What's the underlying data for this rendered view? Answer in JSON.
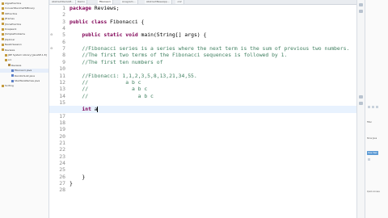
{
  "project_explorer": {
    "items": [
      {
        "label": "AlgosPractice",
        "icon": "folder"
      },
      {
        "label": "ConvertDecimalToBinary",
        "icon": "folder"
      },
      {
        "label": "IOPractice",
        "icon": "folder"
      },
      {
        "label": "JFrames",
        "icon": "folder"
      },
      {
        "label": "JhonsPractice",
        "icon": "folder"
      },
      {
        "label": "Knapsack",
        "icon": "folder"
      },
      {
        "label": "JSimpleProblems",
        "icon": "folder"
      },
      {
        "label": "JSpinner",
        "icon": "folder"
      },
      {
        "label": "NewInSession",
        "icon": "folder"
      },
      {
        "label": "Reviews",
        "icon": "folder"
      },
      {
        "label": "JRE System Library [JavaSE-1.8]",
        "icon": "folder"
      },
      {
        "label": "src",
        "icon": "folder"
      },
      {
        "label": "Reviews",
        "icon": "pkg"
      },
      {
        "label": "Fibonacci.java",
        "icon": "java",
        "selected": true
      },
      {
        "label": "RandomList.java",
        "icon": "java"
      },
      {
        "label": "StarWarsNames.java",
        "icon": "java"
      },
      {
        "label": "Sorting",
        "icon": "folder"
      }
    ]
  },
  "tabs": [
    {
      "label": "AbstractDemoM...",
      "active": false
    },
    {
      "label": "Demo",
      "active": false
    },
    {
      "label": "Fibonacci",
      "active": true
    },
    {
      "label": "Anagram...",
      "active": false
    },
    {
      "label": "AbstractBaseApp...",
      "active": false
    },
    {
      "label": "»12",
      "active": false
    }
  ],
  "code": {
    "line_numbers": [
      "1",
      "2",
      "3",
      "4",
      "5",
      "6",
      "7",
      "8",
      "9",
      "10",
      "11",
      "12",
      "13",
      "14",
      "15",
      "16",
      "17",
      "18",
      "19",
      "20",
      "21",
      "22",
      "23",
      "24",
      "25",
      "26",
      "27",
      "28"
    ],
    "lines": [
      {
        "n": "1",
        "parts": [
          {
            "t": "package Reviews;",
            "c": "plain"
          }
        ]
      },
      {
        "n": "2",
        "parts": []
      },
      {
        "n": "3",
        "parts": [
          {
            "t": "public class Fibonacci {",
            "c": "plain"
          }
        ]
      },
      {
        "n": "4",
        "parts": []
      },
      {
        "n": "5",
        "parts": [
          {
            "t": "    public static void main(String[] args) {",
            "c": "plain"
          }
        ]
      },
      {
        "n": "6",
        "parts": []
      },
      {
        "n": "7",
        "parts": [
          {
            "t": "    //Fibonacci series is a series where the next term is the sum of previous two numbers.",
            "c": "cm"
          }
        ]
      },
      {
        "n": "8",
        "parts": [
          {
            "t": "    //The first two terms of the Fibonacci sequences is followed by 1.",
            "c": "cm"
          }
        ]
      },
      {
        "n": "9",
        "parts": [
          {
            "t": "    //The first ten numbers of",
            "c": "cm"
          }
        ]
      },
      {
        "n": "10",
        "parts": []
      },
      {
        "n": "11",
        "parts": [
          {
            "t": "    //Fibonacci: 1,1,2,3,5,8,13,21,34,55.",
            "c": "cm"
          }
        ]
      },
      {
        "n": "12",
        "parts": [
          {
            "t": "    //            a b c",
            "c": "cm"
          }
        ]
      },
      {
        "n": "13",
        "parts": [
          {
            "t": "    //              a b c",
            "c": "cm"
          }
        ]
      },
      {
        "n": "14",
        "parts": [
          {
            "t": "    //                a b c",
            "c": "cm"
          }
        ]
      },
      {
        "n": "15",
        "parts": []
      },
      {
        "n": "16",
        "parts": [
          {
            "t": "    int a",
            "c": "plain"
          }
        ],
        "current": true
      },
      {
        "n": "17",
        "parts": []
      },
      {
        "n": "18",
        "parts": []
      },
      {
        "n": "19",
        "parts": []
      },
      {
        "n": "20",
        "parts": []
      },
      {
        "n": "21",
        "parts": []
      },
      {
        "n": "22",
        "parts": []
      },
      {
        "n": "23",
        "parts": []
      },
      {
        "n": "24",
        "parts": []
      },
      {
        "n": "25",
        "parts": []
      },
      {
        "n": "26",
        "parts": [
          {
            "t": "    }",
            "c": "plain"
          }
        ]
      },
      {
        "n": "27",
        "parts": [
          {
            "t": "}",
            "c": "plain"
          }
        ]
      },
      {
        "n": "28",
        "parts": []
      }
    ]
  },
  "right_panel": {
    "labels": [
      "Filter",
      "Show Java",
      "Quick Access"
    ],
    "button_label": "New Task"
  },
  "colors": {
    "keyword": "#7f0055",
    "comment": "#3f7f5f",
    "current_line": "#e8f2fe",
    "accent": "#5d9bd5"
  }
}
